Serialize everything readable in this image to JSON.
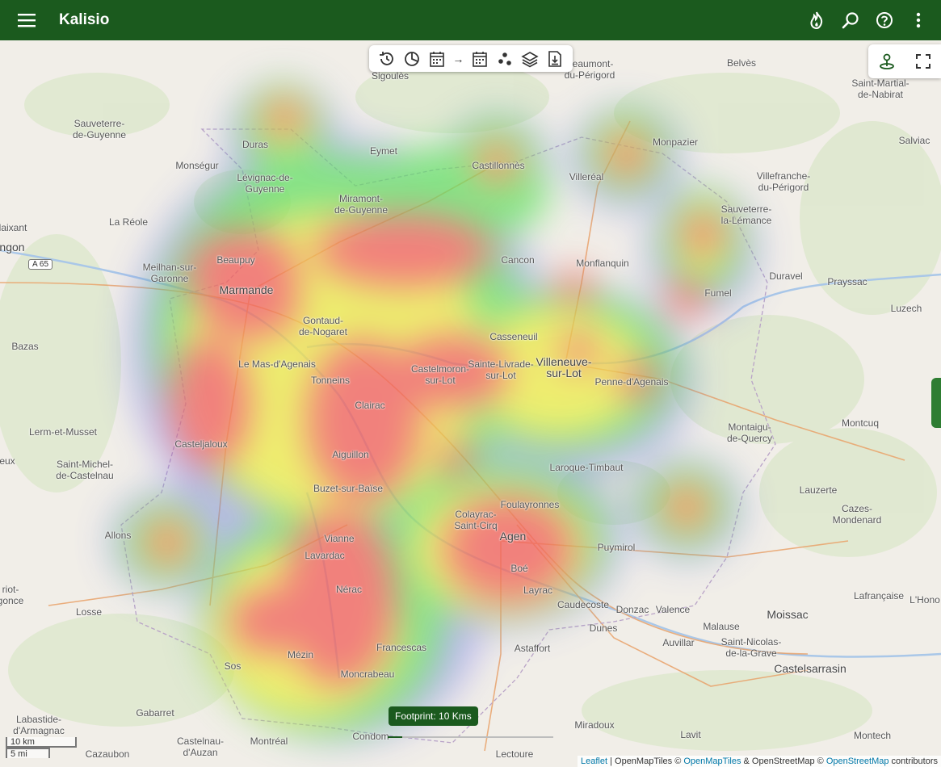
{
  "appbar": {
    "title": "Kalisio"
  },
  "toolbar": {
    "icons": [
      "history-icon",
      "chart-icon",
      "calendar-start-icon",
      "arrow-right-icon",
      "calendar-end-icon",
      "scatter-icon",
      "layers-icon",
      "export-icon"
    ]
  },
  "footprint": {
    "tooltip": "Footprint: 10 Kms",
    "value_fraction": 0.09
  },
  "scale": {
    "km": "10 km",
    "mi": "5 mi"
  },
  "attribution": {
    "leaflet": "Leaflet",
    "sep1": " | OpenMapTiles © ",
    "omt": "OpenMapTiles",
    "mid": " & OpenStreetMap © ",
    "osm": "OpenStreetMap",
    "end": " contributors"
  },
  "map": {
    "road_shield": "A 65",
    "places": [
      {
        "name": "Sigoulès"
      },
      {
        "name": "Beaumont-\ndu-Périgord"
      },
      {
        "name": "Belvès"
      },
      {
        "name": "Saint-Martial-\nde-Nabirat"
      },
      {
        "name": "Sauveterre-\nde-Guyenne"
      },
      {
        "name": "Duras"
      },
      {
        "name": "Eymet"
      },
      {
        "name": "Castillonnès"
      },
      {
        "name": "Monpazier"
      },
      {
        "name": "Salviac"
      },
      {
        "name": "Monségur"
      },
      {
        "name": "Lévignac-de-\nGuyenne"
      },
      {
        "name": "Villeréal"
      },
      {
        "name": "Villefranche-\ndu-Périgord"
      },
      {
        "name": "Miramont-\nde-Guyenne"
      },
      {
        "name": "Sauveterre-\nla-Lémance"
      },
      {
        "name": "La Réole"
      },
      {
        "name": "laixant"
      },
      {
        "name": "Beaupuy"
      },
      {
        "name": "Cancon"
      },
      {
        "name": "Monflanquin"
      },
      {
        "name": "Duravel"
      },
      {
        "name": "Prayssac"
      },
      {
        "name": "Meilhan-sur-\nGaronne"
      },
      {
        "name": "Marmande",
        "big": true
      },
      {
        "name": "Fumel"
      },
      {
        "name": "Luzech"
      },
      {
        "name": "Gontaud-\nde-Nogaret"
      },
      {
        "name": "Casseneuil"
      },
      {
        "name": "Bazas"
      },
      {
        "name": "Le Mas-d'Agenais"
      },
      {
        "name": "Castelmoron-\nsur-Lot"
      },
      {
        "name": "Sainte-Livrade-\nsur-Lot"
      },
      {
        "name": "Villeneuve-\nsur-Lot",
        "big": true
      },
      {
        "name": "Tonneins"
      },
      {
        "name": "Penne-d'Agenais"
      },
      {
        "name": "Clairac"
      },
      {
        "name": "Montaigu-\nde-Quercy"
      },
      {
        "name": "Montcuq"
      },
      {
        "name": "Lerm-et-Musset"
      },
      {
        "name": "Casteljaloux"
      },
      {
        "name": "Aiguillon"
      },
      {
        "name": "Laroque-Timbaut"
      },
      {
        "name": "Saint-Michel-\nde-Castelnau"
      },
      {
        "name": "eux"
      },
      {
        "name": "Buzet-sur-Baïse"
      },
      {
        "name": "Lauzerte"
      },
      {
        "name": "Foulayronnes"
      },
      {
        "name": "Colayrac-\nSaint-Cirq"
      },
      {
        "name": "Cazes-\nMondenard"
      },
      {
        "name": "Allons"
      },
      {
        "name": "Vianne"
      },
      {
        "name": "Agen",
        "big": true
      },
      {
        "name": "Puymirol"
      },
      {
        "name": "Lavardac"
      },
      {
        "name": "Boé"
      },
      {
        "name": "riot-\ngonce"
      },
      {
        "name": "Nérac"
      },
      {
        "name": "Layrac"
      },
      {
        "name": "Lafrançaise"
      },
      {
        "name": "L'Hono"
      },
      {
        "name": "Losse"
      },
      {
        "name": "Caudecoste"
      },
      {
        "name": "Donzac"
      },
      {
        "name": "Valence"
      },
      {
        "name": "Moissac",
        "big": true
      },
      {
        "name": "Dunes"
      },
      {
        "name": "Malause"
      },
      {
        "name": "Mézin"
      },
      {
        "name": "Francescas"
      },
      {
        "name": "Astaffort"
      },
      {
        "name": "Auvillar"
      },
      {
        "name": "Saint-Nicolas-\nde-la-Grave"
      },
      {
        "name": "Sos"
      },
      {
        "name": "Moncrabeau"
      },
      {
        "name": "Castelsarrasin",
        "big": true
      },
      {
        "name": "Miradoux"
      },
      {
        "name": "Gabarret"
      },
      {
        "name": "Labastide-\nd'Armagnac"
      },
      {
        "name": "Condom"
      },
      {
        "name": "Castelnau-\nd'Auzan"
      },
      {
        "name": "Montréal"
      },
      {
        "name": "Lavit"
      },
      {
        "name": "Montech"
      },
      {
        "name": "Cazaubon"
      },
      {
        "name": "Lectoure"
      },
      {
        "name": "ngon",
        "big": true
      }
    ]
  }
}
